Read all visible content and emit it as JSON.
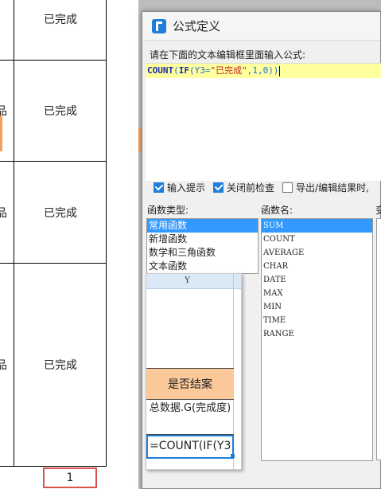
{
  "background_table": {
    "rows": [
      {
        "left": "",
        "status": "已完成"
      },
      {
        "left": "品",
        "status": "已完成"
      },
      {
        "left": "品",
        "status": "已完成"
      },
      {
        "left": "品",
        "status": "已完成"
      }
    ],
    "page_number": "1"
  },
  "dialog": {
    "title": "公式定义",
    "prompt": "请在下面的文本编辑框里面输入公式:",
    "formula_tokens": {
      "fn1": "COUNT",
      "p1": "(",
      "fn2": "IF",
      "p2": "(",
      "ref": "Y3",
      "eq": "=",
      "str": "\"已完成\"",
      "rest": ",1,0))"
    },
    "options": {
      "input_hint": "输入提示",
      "check_on_close": "关闭前检查",
      "export_edit": "导出/编辑结果时,"
    },
    "labels": {
      "func_type": "函数类型:",
      "func_name": "函数名:",
      "variable": "变"
    },
    "func_types": [
      "常用函数",
      "新增函数",
      "数学和三角函数",
      "文本函数"
    ],
    "func_names": [
      "SUM",
      "COUNT",
      "AVERAGE",
      "CHAR",
      "DATE",
      "MAX",
      "MIN",
      "TIME",
      "RANGE"
    ]
  },
  "popup_sheet": {
    "column_header": "Y",
    "cell_header": "是否结案",
    "cell_data": "总数据.G(完成度)",
    "cell_formula": "=COUNT(IF(Y3"
  },
  "colors": {
    "accent": "#1e7ed8",
    "selected": "#3399ff",
    "orange_cell": "#fbc89a",
    "page_box_border": "#d9534f"
  }
}
